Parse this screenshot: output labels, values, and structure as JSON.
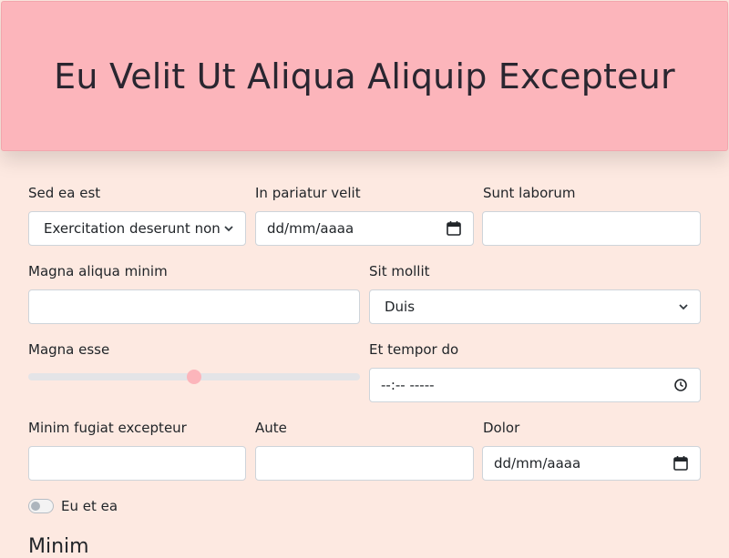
{
  "header": {
    "title": "Eu Velit Ut Aliqua Aliquip Excepteur"
  },
  "form": {
    "row1": {
      "select": {
        "label": "Sed ea est",
        "value": "Exercitation deserunt non"
      },
      "date": {
        "label": "In pariatur velit",
        "placeholder": "dd/mm/aaaa"
      },
      "text": {
        "label": "Sunt laborum",
        "value": ""
      }
    },
    "row2": {
      "text": {
        "label": "Magna aliqua minim",
        "value": ""
      },
      "select": {
        "label": "Sit mollit",
        "value": "Duis"
      }
    },
    "row3": {
      "range": {
        "label": "Magna esse",
        "value": 0.5
      },
      "time": {
        "label": "Et tempor do",
        "placeholder": "--:-- -----"
      }
    },
    "row4": {
      "text1": {
        "label": "Minim fugiat excepteur",
        "value": ""
      },
      "text2": {
        "label": "Aute",
        "value": ""
      },
      "date": {
        "label": "Dolor",
        "placeholder": "dd/mm/aaaa"
      }
    },
    "toggle": {
      "label": "Eu et ea",
      "checked": false
    },
    "next_section": {
      "title": "Minim"
    }
  },
  "colors": {
    "accent": "#fcb5bb",
    "background": "#fde9e1"
  },
  "icons": {
    "select_arrow": "chevron-down-icon",
    "date": "calendar-icon",
    "time": "clock-icon"
  }
}
